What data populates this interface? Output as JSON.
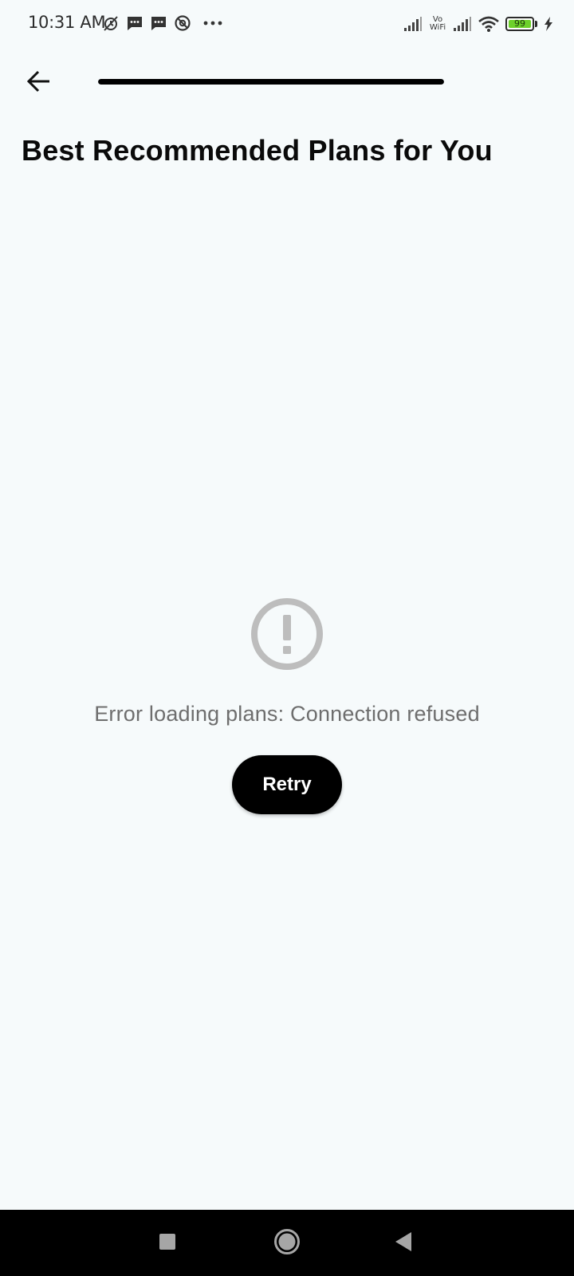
{
  "status_bar": {
    "time": "10:31 AM",
    "left_icons": [
      "alarm-off-icon",
      "message-icon",
      "message-icon",
      "at-sign-icon",
      "more-dots-icon"
    ],
    "vowifi_top": "Vo",
    "vowifi_bottom": "WiFi",
    "battery_level": "99",
    "battery_percent": 99,
    "charging": true
  },
  "app_bar": {
    "back_icon": "arrow-left-icon",
    "progress_percent": 100
  },
  "page": {
    "title": "Best Recommended Plans for You"
  },
  "error_state": {
    "icon": "alert-circle-icon",
    "message": "Error loading plans: Connection refused",
    "retry_label": "Retry"
  },
  "nav_bar": {
    "recent_icon": "square-icon",
    "home_icon": "circle-icon",
    "back_icon": "triangle-back-icon"
  }
}
